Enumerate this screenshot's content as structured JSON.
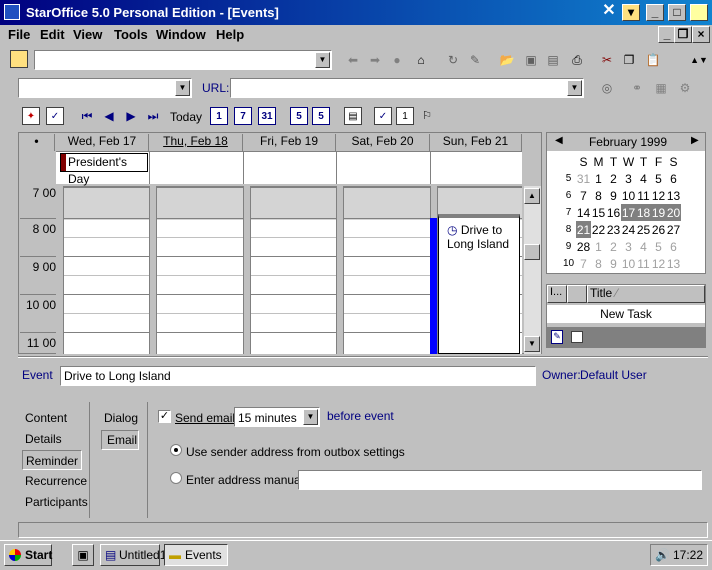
{
  "window": {
    "title": "StarOffice 5.0 Personal Edition - [Events]"
  },
  "menu": [
    "File",
    "Edit",
    "View",
    "Tools",
    "Window",
    "Help"
  ],
  "url_label": "URL:",
  "nav": {
    "today": "Today"
  },
  "days": [
    {
      "label": "Wed, Feb 17"
    },
    {
      "label": "Thu, Feb 18"
    },
    {
      "label": "Fri, Feb 19"
    },
    {
      "label": "Sat, Feb 20"
    },
    {
      "label": "Sun, Feb 21"
    }
  ],
  "allday_event": "President's Day",
  "times": [
    "7 00",
    "8 00",
    "9 00",
    "10 00",
    "11 00"
  ],
  "event_block": {
    "title": "Drive to Long Island"
  },
  "mini_cal": {
    "month": "February 1999",
    "weekdays": [
      "S",
      "M",
      "T",
      "W",
      "T",
      "F",
      "S"
    ],
    "weeks": [
      {
        "num": "5",
        "days": [
          "31",
          "1",
          "2",
          "3",
          "4",
          "5",
          "6"
        ]
      },
      {
        "num": "6",
        "days": [
          "7",
          "8",
          "9",
          "10",
          "11",
          "12",
          "13"
        ]
      },
      {
        "num": "7",
        "days": [
          "14",
          "15",
          "16",
          "17",
          "18",
          "19",
          "20"
        ]
      },
      {
        "num": "8",
        "days": [
          "21",
          "22",
          "23",
          "24",
          "25",
          "26",
          "27"
        ]
      },
      {
        "num": "9",
        "days": [
          "28",
          "1",
          "2",
          "3",
          "4",
          "5",
          "6"
        ]
      },
      {
        "num": "10",
        "days": [
          "7",
          "8",
          "9",
          "10",
          "11",
          "12",
          "13"
        ]
      }
    ]
  },
  "tasks": {
    "col1": "I...",
    "col2": "Title",
    "new_task": "New Task"
  },
  "event_form": {
    "event_label": "Event",
    "event_value": "Drive to Long Island",
    "owner_label": "Owner:",
    "owner_value": "Default User"
  },
  "left_tabs": [
    "Content",
    "Details",
    "Reminder",
    "Recurrence",
    "Participants"
  ],
  "sub_tabs": [
    "Dialog",
    "Email"
  ],
  "reminder": {
    "send_email_label": "Send email",
    "interval": "15 minutes",
    "before_label": "before event",
    "use_sender": "Use sender address from outbox settings",
    "enter_manually": "Enter address manually"
  },
  "taskbar": {
    "start": "Start",
    "task1": "Untitled1",
    "task2": "Events",
    "clock": "17:22"
  }
}
